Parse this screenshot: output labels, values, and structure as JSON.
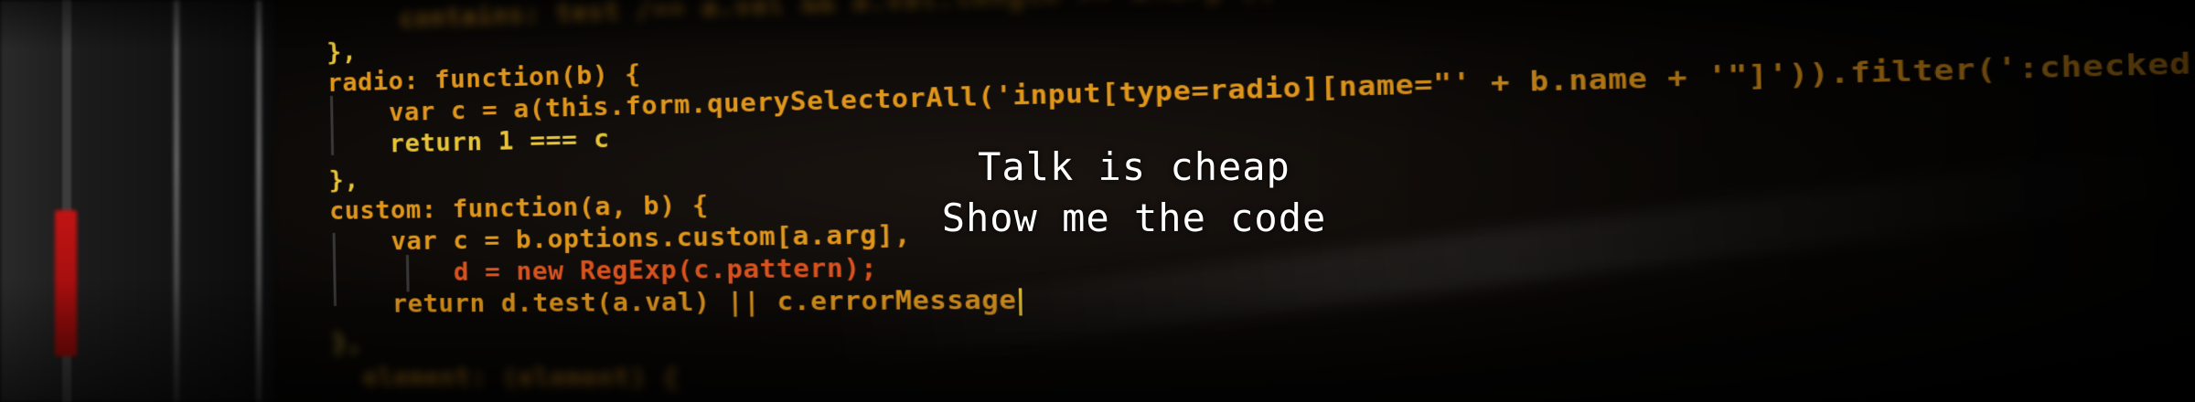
{
  "tagline": {
    "line1": "Talk is cheap",
    "line2": "Show me the code"
  },
  "code_lines": [
    {
      "text": "contains: test /== a.val && a.val.length >= a.arg || customValidity(a.condition)",
      "class": "kw-orange very-blurred"
    },
    {
      "text": "},",
      "class": "kw-yellow"
    },
    {
      "text": "radio: function(b) {",
      "class": "kw-orange"
    },
    {
      "text": "    var c = a(this.form.querySelectorAll('input[type=radio][name=\"' + b.name + '\"]')).filter(':checked').length",
      "class": "kw-orange"
    },
    {
      "text": "    return 1 === c",
      "class": "kw-yellow"
    },
    {
      "text": "},",
      "class": "kw-yellow"
    },
    {
      "text": "custom: function(a, b) {",
      "class": "kw-orange"
    },
    {
      "text": "    var c = b.options.custom[a.arg],",
      "class": "kw-orange"
    },
    {
      "text": "        d = new RegExp(c.pattern);",
      "class": "kw-red"
    },
    {
      "text": "    return d.test(a.val) || c.errorMessage",
      "class": "kw-orange"
    },
    {
      "text": "},",
      "class": "kw-yellow very-blurred"
    },
    {
      "text": "  element: (element) {",
      "class": "kw-orange very-blurred"
    }
  ],
  "colors": {
    "background": "#050505",
    "keyword": "#e7c338",
    "identifier": "#e0961b",
    "string": "#d9521e",
    "scrollbar_thumb": "#c21414",
    "tagline": "#ffffff"
  }
}
